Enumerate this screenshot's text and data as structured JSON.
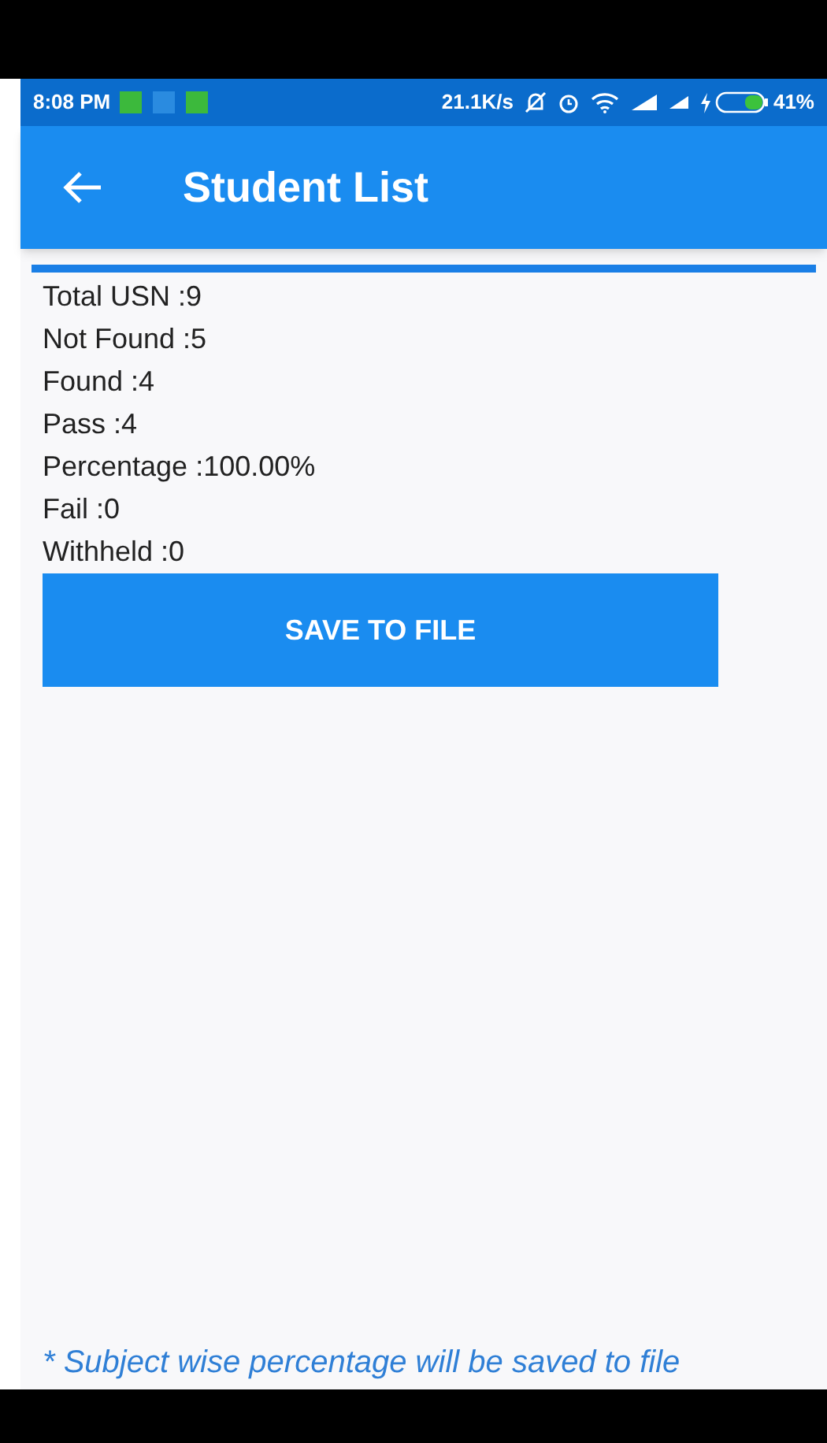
{
  "status_bar": {
    "time": "8:08 PM",
    "speed": "21.1K/s",
    "battery": "41%"
  },
  "app_bar": {
    "title": "Student List"
  },
  "progress": {
    "level": 1
  },
  "stats": [
    "Total USN :9",
    "Not Found :5",
    "Found :4",
    "Pass :4",
    "Percentage :100.00%",
    "Fail :0",
    "Withheld :0"
  ],
  "save_button": {
    "label": "SAVE TO FILE"
  },
  "footnote": "* Subject wise percentage will be saved to file"
}
